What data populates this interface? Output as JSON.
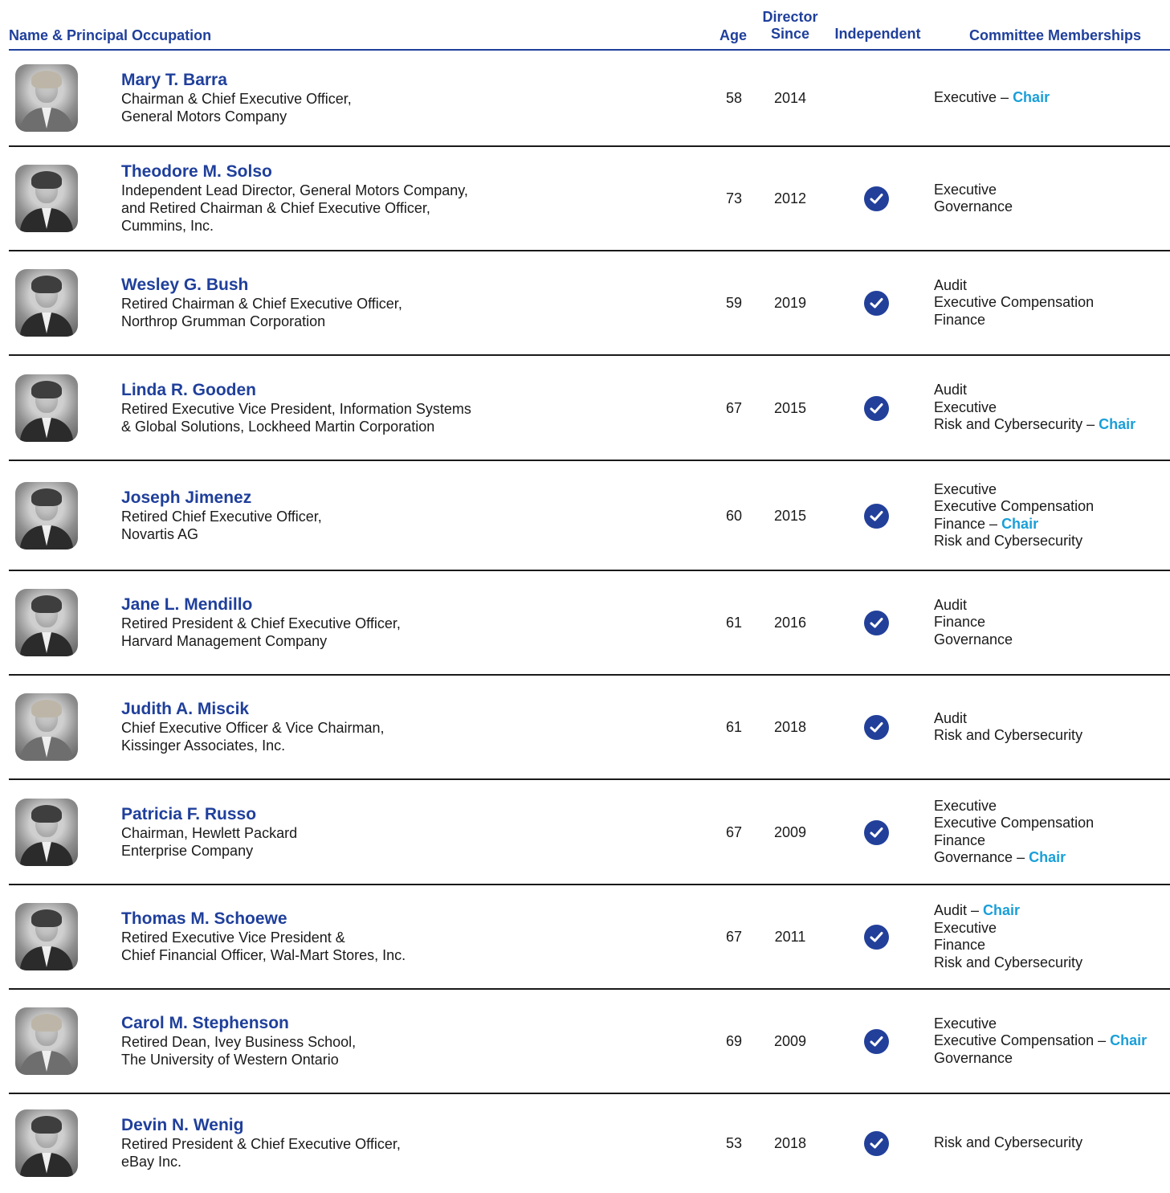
{
  "header": {
    "name": "Name & Principal Occupation",
    "age": "Age",
    "director_since_1": "Director",
    "director_since_2": "Since",
    "independent": "Independent",
    "committees": "Committee Memberships"
  },
  "colors": {
    "heading": "#1f3f9b",
    "chair": "#1a9fd8",
    "check": "#22409a"
  },
  "chair_label": "Chair",
  "directors": [
    {
      "name": "Mary T. Barra",
      "occupation": [
        "Chairman & Chief Executive Officer,",
        "General Motors Company"
      ],
      "age": "58",
      "since": "2014",
      "independent": false,
      "committees": [
        {
          "label": "Executive",
          "chair": true
        }
      ]
    },
    {
      "name": "Theodore M. Solso",
      "occupation": [
        "Independent Lead Director, General Motors Company,",
        "and Retired Chairman & Chief Executive Officer,",
        "Cummins, Inc."
      ],
      "age": "73",
      "since": "2012",
      "independent": true,
      "committees": [
        {
          "label": "Executive",
          "chair": false
        },
        {
          "label": "Governance",
          "chair": false
        }
      ]
    },
    {
      "name": "Wesley G. Bush",
      "occupation": [
        "Retired Chairman & Chief Executive Officer,",
        "Northrop Grumman Corporation"
      ],
      "age": "59",
      "since": "2019",
      "independent": true,
      "committees": [
        {
          "label": "Audit",
          "chair": false
        },
        {
          "label": "Executive Compensation",
          "chair": false
        },
        {
          "label": "Finance",
          "chair": false
        }
      ]
    },
    {
      "name": "Linda R. Gooden",
      "occupation": [
        "Retired Executive Vice President, Information Systems",
        "& Global Solutions, Lockheed Martin Corporation"
      ],
      "age": "67",
      "since": "2015",
      "independent": true,
      "committees": [
        {
          "label": "Audit",
          "chair": false
        },
        {
          "label": "Executive",
          "chair": false
        },
        {
          "label": "Risk and Cybersecurity",
          "chair": true
        }
      ]
    },
    {
      "name": "Joseph Jimenez",
      "occupation": [
        "Retired Chief Executive Officer,",
        "Novartis AG"
      ],
      "age": "60",
      "since": "2015",
      "independent": true,
      "committees": [
        {
          "label": "Executive",
          "chair": false
        },
        {
          "label": "Executive Compensation",
          "chair": false
        },
        {
          "label": "Finance",
          "chair": true
        },
        {
          "label": "Risk and Cybersecurity",
          "chair": false
        }
      ]
    },
    {
      "name": "Jane L. Mendillo",
      "occupation": [
        "Retired President & Chief Executive Officer,",
        "Harvard Management Company"
      ],
      "age": "61",
      "since": "2016",
      "independent": true,
      "committees": [
        {
          "label": "Audit",
          "chair": false
        },
        {
          "label": "Finance",
          "chair": false
        },
        {
          "label": "Governance",
          "chair": false
        }
      ]
    },
    {
      "name": "Judith A. Miscik",
      "occupation": [
        "Chief Executive Officer & Vice Chairman,",
        "Kissinger Associates, Inc."
      ],
      "age": "61",
      "since": "2018",
      "independent": true,
      "committees": [
        {
          "label": "Audit",
          "chair": false
        },
        {
          "label": "Risk and Cybersecurity",
          "chair": false
        }
      ]
    },
    {
      "name": "Patricia F. Russo",
      "occupation": [
        "Chairman, Hewlett Packard",
        "Enterprise Company"
      ],
      "age": "67",
      "since": "2009",
      "independent": true,
      "committees": [
        {
          "label": "Executive",
          "chair": false
        },
        {
          "label": "Executive Compensation",
          "chair": false
        },
        {
          "label": "Finance",
          "chair": false
        },
        {
          "label": "Governance",
          "chair": true
        }
      ]
    },
    {
      "name": "Thomas M. Schoewe",
      "occupation": [
        "Retired Executive Vice President &",
        "Chief Financial Officer, Wal-Mart Stores, Inc."
      ],
      "age": "67",
      "since": "2011",
      "independent": true,
      "committees": [
        {
          "label": "Audit",
          "chair": true
        },
        {
          "label": "Executive",
          "chair": false
        },
        {
          "label": "Finance",
          "chair": false
        },
        {
          "label": "Risk and Cybersecurity",
          "chair": false
        }
      ]
    },
    {
      "name": "Carol M. Stephenson",
      "occupation": [
        "Retired Dean, Ivey Business School,",
        "The University of Western Ontario"
      ],
      "age": "69",
      "since": "2009",
      "independent": true,
      "committees": [
        {
          "label": "Executive",
          "chair": false
        },
        {
          "label": "Executive Compensation",
          "chair": true
        },
        {
          "label": "Governance",
          "chair": false
        }
      ]
    },
    {
      "name": "Devin N. Wenig",
      "occupation": [
        "Retired President & Chief Executive Officer,",
        "eBay Inc."
      ],
      "age": "53",
      "since": "2018",
      "independent": true,
      "committees": [
        {
          "label": "Risk and Cybersecurity",
          "chair": false
        }
      ]
    }
  ]
}
